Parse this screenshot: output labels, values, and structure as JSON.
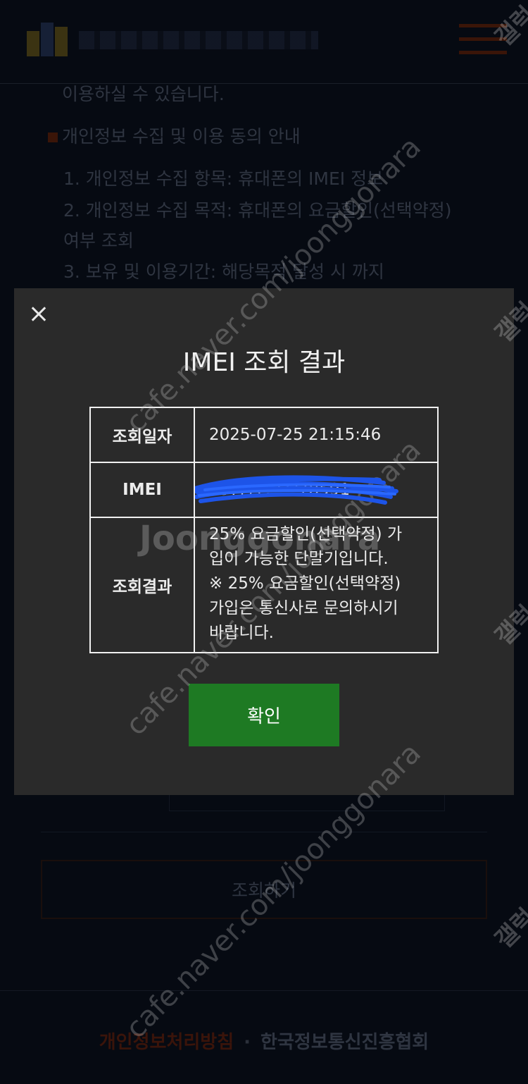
{
  "background": {
    "lines": [
      "이용하실 수 있습니다.",
      "개인정보 수집 및 이용 동의 안내",
      "1. 개인정보 수집 항목: 휴대폰의 IMEI 정보",
      "2. 개인정보 수집 목적: 휴대폰의 요금할인(선택약정)",
      "여부 조회",
      "3. 보유 및 이용기간: 해당목적 달성 시 까지"
    ],
    "lookup_button": "조회하기",
    "footer": {
      "privacy": "개인정보처리방침",
      "separator": "·",
      "association": "한국정보통신진흥협회"
    }
  },
  "modal": {
    "title": "IMEI 조회 결과",
    "rows": {
      "date_label": "조회일자",
      "date_value": "2025-07-25 21:15:46",
      "imei_label": "IMEI",
      "imei_value": "35????????78591",
      "result_label": "조회결과",
      "result_lines": [
        "25% 요금할인(선택약정) 가",
        "입이 가능한 단말기입니다.",
        "※ 25% 요금할인(선택약정)",
        "가입은 통신사로 문의하시기",
        "바랍니다."
      ]
    },
    "confirm_button": "확인"
  },
  "watermarks": {
    "site": "cafe.naver.com/joonggonara",
    "brand": "Joonggonara",
    "side": "갤럭"
  },
  "colors": {
    "modal_bg": "#2a2a2a",
    "confirm_green": "#1e7a23",
    "page_bg": "#060a12"
  }
}
